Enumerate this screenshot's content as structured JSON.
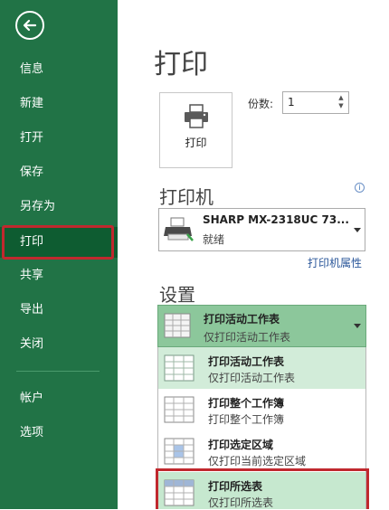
{
  "sidebar": {
    "items": [
      {
        "label": "信息"
      },
      {
        "label": "新建"
      },
      {
        "label": "打开"
      },
      {
        "label": "保存"
      },
      {
        "label": "另存为"
      },
      {
        "label": "打印"
      },
      {
        "label": "共享"
      },
      {
        "label": "导出"
      },
      {
        "label": "关闭"
      },
      {
        "label": "帐户"
      },
      {
        "label": "选项"
      }
    ]
  },
  "main": {
    "title": "打印",
    "print_button_label": "打印",
    "copies_label": "份数:",
    "copies_value": "1",
    "printer_heading": "打印机",
    "printer": {
      "name": "SHARP MX-2318UC 73...",
      "status": "就绪"
    },
    "printer_properties": "打印机属性",
    "settings_heading": "设置",
    "settings_selected": {
      "title": "打印活动工作表",
      "subtitle": "仅打印活动工作表"
    },
    "options": [
      {
        "title": "打印活动工作表",
        "subtitle": "仅打印活动工作表"
      },
      {
        "title": "打印整个工作簿",
        "subtitle": "打印整个工作簿"
      },
      {
        "title": "打印选定区域",
        "subtitle": "仅打印当前选定区域"
      },
      {
        "title": "打印所选表",
        "subtitle": "仅打印所选表"
      }
    ]
  },
  "colors": {
    "sidebar_bg": "#217346",
    "sidebar_active": "#0e5c31",
    "highlight_red": "#c0282e",
    "selected_green": "#8cc79b",
    "link_blue": "#2b579a"
  }
}
